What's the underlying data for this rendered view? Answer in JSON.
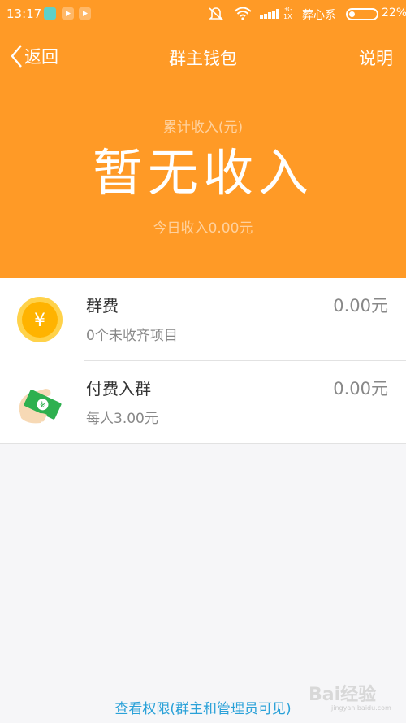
{
  "status_bar": {
    "time": "13:17",
    "network": "3G\n1X",
    "carrier": "葬心系",
    "battery_pct": "22%",
    "battery_level": 0.22
  },
  "nav": {
    "back_label": "返回",
    "title": "群主钱包",
    "help_label": "说明"
  },
  "summary": {
    "income_label": "累计收入(元)",
    "income_value": "暂无收入",
    "today_income": "今日收入0.00元"
  },
  "rows": [
    {
      "title": "群费",
      "subtitle": "0个未收齐项目",
      "amount": "0.00元",
      "icon": "yuan-coin-icon"
    },
    {
      "title": "付费入群",
      "subtitle": "每人3.00元",
      "amount": "0.00元",
      "icon": "hand-money-icon"
    }
  ],
  "footer": {
    "link": "查看权限(群主和管理员可见)"
  },
  "watermark": {
    "brand": "Bai经验",
    "url": "jingyan.baidu.com"
  },
  "colors": {
    "header": "#ff9a26",
    "link": "#2aa1d8",
    "coin": "#ffb300",
    "cash": "#2eb04f"
  }
}
